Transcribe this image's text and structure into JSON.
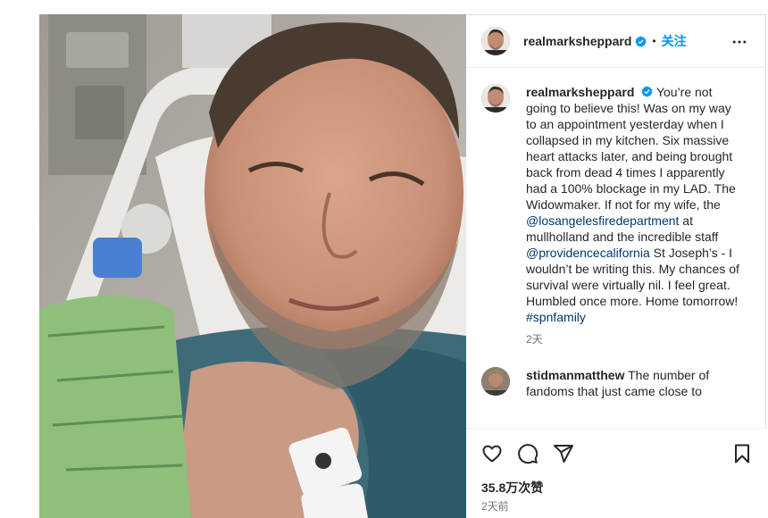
{
  "post": {
    "username": "realmarksheppard",
    "verified": true,
    "separator": "•",
    "follow_label": "关注",
    "more_icon": "more-horizontal-icon",
    "photo_description": "hospital-selfie-photo"
  },
  "caption": {
    "username": "realmarksheppard",
    "text_1": "You’re not going to believe this! Was on my way to an appointment yesterday when I collapsed in my kitchen. Six massive heart attacks later, and being brought back from dead 4 times I apparently had a 100% blockage in my LAD. The Widowmaker. If not for my wife, the ",
    "mention_1": "@losangelesfiredepartment",
    "text_2": " at mullholland and the incredible staff ",
    "mention_2": "@providencecalifornia",
    "text_3": " St Joseph’s - I wouldn’t be writing this. My chances of survival were virtually nil. I feel great. Humbled once more. Home tomorrow! ",
    "hashtag": "#spnfamily",
    "time": "2天"
  },
  "comment": {
    "username": "stidmanmatthew",
    "text": "The number of fandoms that just came close to"
  },
  "actions": {
    "like_icon": "heart-icon",
    "comment_icon": "comment-icon",
    "share_icon": "send-icon",
    "save_icon": "bookmark-icon",
    "likes": "35.8万次赞",
    "posted": "2天前"
  },
  "colors": {
    "accent": "#0095f6",
    "mention": "#00376b",
    "text": "#262626",
    "muted": "#737373"
  }
}
